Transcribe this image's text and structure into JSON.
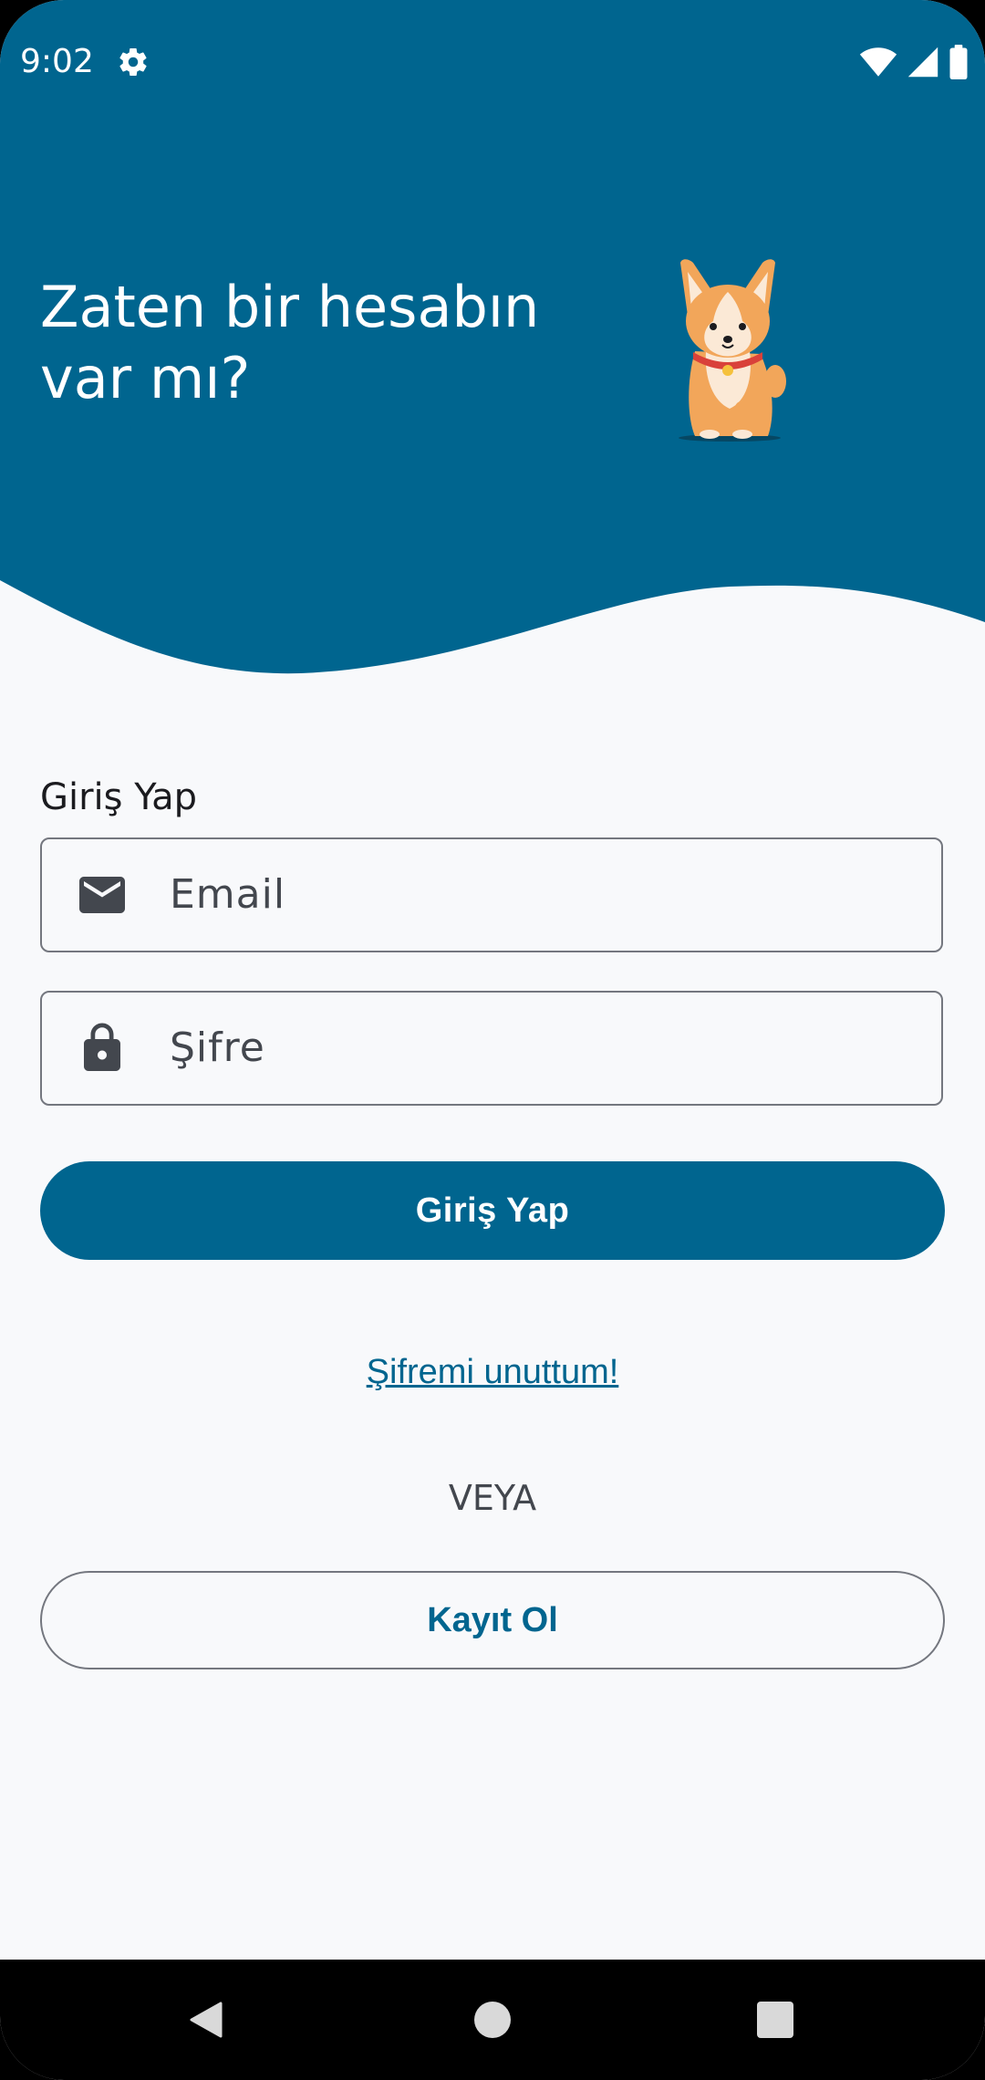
{
  "status_bar": {
    "time": "9:02",
    "settings_icon": "gear-icon",
    "wifi_icon": "wifi-icon",
    "signal_icon": "cellular-signal-icon",
    "battery_icon": "battery-icon"
  },
  "header": {
    "headline": "Zaten bir hesabın var mı?",
    "background_color": "#00658f",
    "mascot": "corgi-dog-illustration"
  },
  "form": {
    "section_title": "Giriş Yap",
    "email": {
      "placeholder": "Email",
      "value": "",
      "icon": "envelope-icon"
    },
    "password": {
      "placeholder": "Şifre",
      "value": "",
      "icon": "lock-icon"
    },
    "login_button_label": "Giriş Yap",
    "forgot_password_label": "Şifremi unuttum!",
    "or_label": "VEYA",
    "register_button_label": "Kayıt Ol"
  },
  "colors": {
    "primary": "#00658f",
    "surface": "#f8f9fb",
    "outline": "#74777f",
    "on_surface_variant": "#43474e"
  },
  "nav_bar": {
    "back_icon": "back-triangle-icon",
    "home_icon": "home-circle-icon",
    "recents_icon": "recents-square-icon"
  }
}
